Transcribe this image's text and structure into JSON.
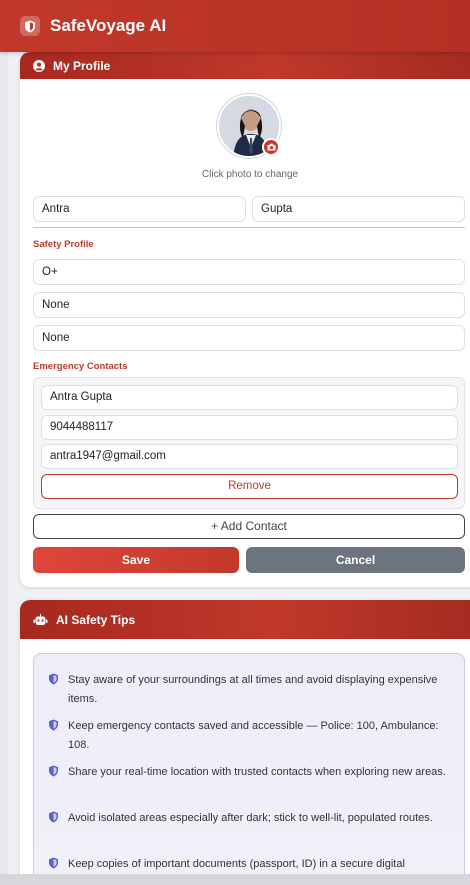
{
  "app": {
    "title": "SafeVoyage AI"
  },
  "profile": {
    "header": "My Profile",
    "photo_hint": "Click photo to change",
    "first_name": "Antra",
    "last_name": "Gupta",
    "safety_label": "Safety Profile",
    "blood_group": "O+",
    "allergies": "None",
    "medical_conditions": "None",
    "contacts_label": "Emergency Contacts",
    "contact": {
      "name": "Antra Gupta",
      "phone": "9044488117",
      "email": "antra1947@gmail.com"
    },
    "remove_label": "Remove",
    "add_contact_label": "+ Add Contact",
    "save_label": "Save",
    "cancel_label": "Cancel"
  },
  "tips": {
    "header": "AI Safety Tips",
    "items": [
      "Stay aware of your surroundings at all times and avoid displaying expensive items.",
      "Keep emergency contacts saved and accessible — Police: 100, Ambulance: 108.",
      "Share your real-time location with trusted contacts when exploring new areas.",
      "Avoid isolated areas especially after dark; stick to well-lit, populated routes.",
      "Keep copies of important documents (passport, ID) in a secure digital"
    ]
  },
  "colors": {
    "brand": "#c0392b",
    "cancel": "#6c757d",
    "tip_icon": "#5b63c9"
  },
  "icons": {
    "logo": "shield-icon",
    "profile": "user-circle-icon",
    "camera": "camera-icon",
    "tips": "robot-icon",
    "tip_bullet": "shield-icon"
  }
}
